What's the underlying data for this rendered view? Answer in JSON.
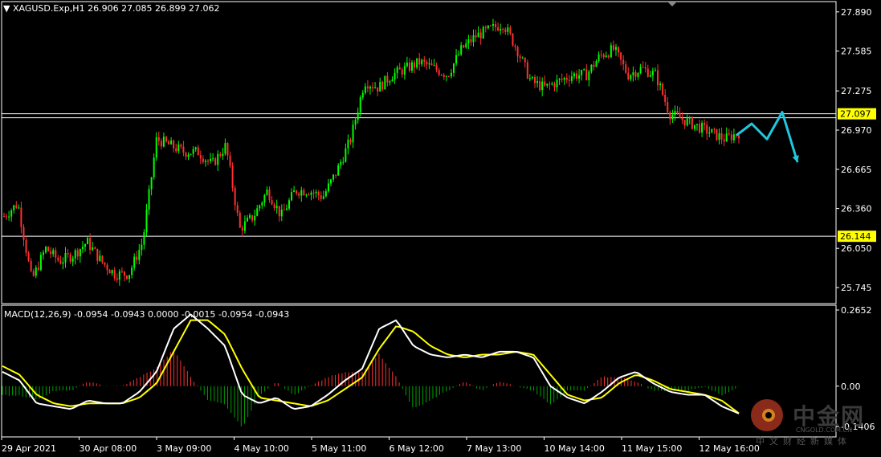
{
  "header": {
    "symbol": "XAGUSD.Exp,H1",
    "ohlc": "26.906 27.085 26.899 27.062",
    "indicator": "MACD(12,26,9) -0.0954 -0.0943 0.0000 -0.0015 -0.0954 -0.0943"
  },
  "watermark": {
    "brand": "中金网",
    "domain": "CNGOLD.COM.CN",
    "tagline": "中文财经新媒体"
  },
  "colors": {
    "background": "#000000",
    "bull_candle": "#00ff00",
    "bear_candle": "#ff3030",
    "macd_line": "#ffffff",
    "signal_line": "#ffff00",
    "histogram_pos": "#ff3030",
    "histogram_neg": "#00a000",
    "forecast_arrow": "#1ec8e0",
    "level_label_bg": "#ffff00"
  },
  "chart_data": {
    "type": "candlestick",
    "price_axis_ticks": [
      "27.890",
      "27.585",
      "27.275",
      "26.970",
      "26.665",
      "26.360",
      "26.050",
      "25.745"
    ],
    "price_range": [
      25.62,
      27.97
    ],
    "horizontal_levels": [
      {
        "label": "27.097",
        "value": 27.097
      },
      {
        "label": "26.144",
        "value": 26.144
      }
    ],
    "time_labels": [
      "29 Apr 2021",
      "30 Apr 08:00",
      "3 May 09:00",
      "4 May 10:00",
      "5 May 11:00",
      "6 May 12:00",
      "7 May 13:00",
      "10 May 14:00",
      "11 May 15:00",
      "12 May 16:00"
    ],
    "price_path": [
      26.3,
      26.4,
      25.8,
      26.05,
      25.95,
      26.0,
      26.1,
      25.95,
      25.85,
      25.85,
      26.1,
      26.9,
      26.85,
      26.8,
      26.8,
      26.7,
      26.85,
      26.2,
      26.3,
      26.5,
      26.3,
      26.5,
      26.5,
      26.45,
      26.65,
      26.9,
      27.35,
      27.3,
      27.4,
      27.45,
      27.5,
      27.45,
      27.4,
      27.6,
      27.7,
      27.75,
      27.8,
      27.6,
      27.35,
      27.3,
      27.35,
      27.4,
      27.4,
      27.55,
      27.6,
      27.4,
      27.45,
      27.4,
      27.1,
      27.05,
      27.0,
      26.95,
      26.9,
      26.95
    ],
    "macd": {
      "params": "12,26,9",
      "range": [
        -0.16,
        0.2652
      ],
      "axis_ticks": [
        "0.2652",
        "0.00",
        "-0.1406"
      ],
      "main": [
        0.05,
        0.02,
        -0.06,
        -0.07,
        -0.08,
        -0.05,
        -0.06,
        -0.06,
        -0.02,
        0.05,
        0.2,
        0.25,
        0.2,
        0.14,
        -0.03,
        -0.06,
        -0.04,
        -0.08,
        -0.07,
        -0.03,
        0.02,
        0.06,
        0.2,
        0.23,
        0.14,
        0.11,
        0.1,
        0.11,
        0.1,
        0.12,
        0.12,
        0.1,
        0.0,
        -0.04,
        -0.06,
        -0.02,
        0.03,
        0.05,
        0.01,
        -0.02,
        -0.03,
        -0.03,
        -0.07,
        -0.0954
      ],
      "signal": [
        0.07,
        0.04,
        -0.03,
        -0.06,
        -0.07,
        -0.06,
        -0.06,
        -0.06,
        -0.04,
        0.01,
        0.12,
        0.23,
        0.23,
        0.18,
        0.06,
        -0.04,
        -0.05,
        -0.06,
        -0.07,
        -0.05,
        -0.01,
        0.03,
        0.13,
        0.21,
        0.19,
        0.14,
        0.11,
        0.1,
        0.11,
        0.11,
        0.12,
        0.11,
        0.04,
        -0.03,
        -0.05,
        -0.04,
        0.01,
        0.04,
        0.02,
        -0.01,
        -0.02,
        -0.03,
        -0.05,
        -0.0943
      ]
    },
    "forecast_arrow": {
      "points": [
        [
          0,
          26.93
        ],
        [
          1,
          27.02
        ],
        [
          2,
          26.9
        ],
        [
          3,
          27.11
        ],
        [
          4,
          26.72
        ]
      ],
      "color": "#1ec8e0"
    }
  }
}
